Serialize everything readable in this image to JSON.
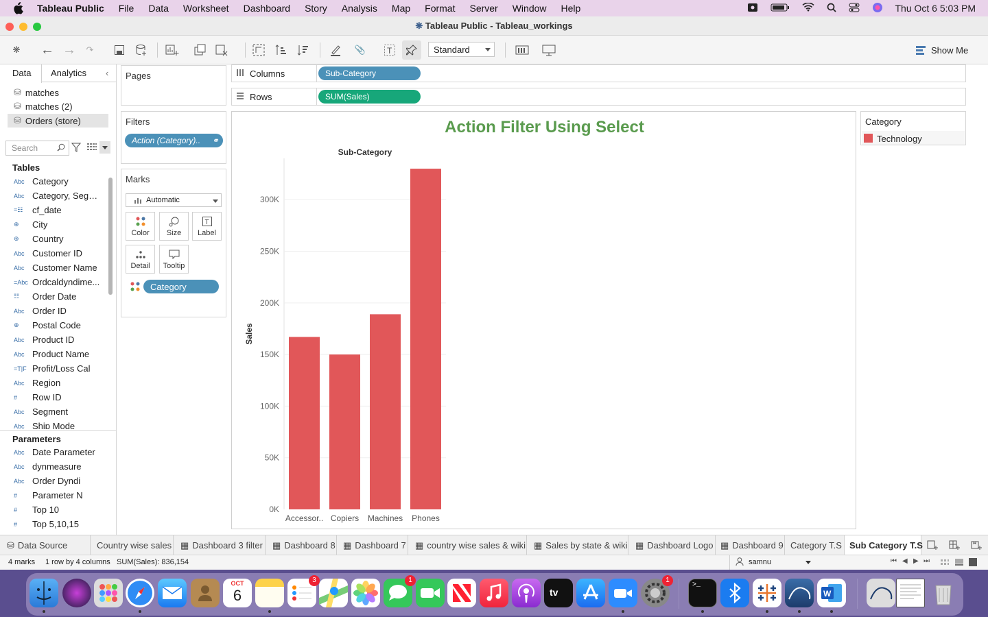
{
  "menubar": {
    "app": "Tableau Public",
    "items": [
      "File",
      "Data",
      "Worksheet",
      "Dashboard",
      "Story",
      "Analysis",
      "Map",
      "Format",
      "Server",
      "Window",
      "Help"
    ],
    "clock": "Thu Oct 6  5:03 PM"
  },
  "window": {
    "title": "Tableau Public - Tableau_workings"
  },
  "toolbar": {
    "fit": "Standard",
    "show_me": "Show Me"
  },
  "datapane": {
    "tab_data": "Data",
    "tab_analytics": "Analytics",
    "sources": [
      "matches",
      "matches (2)",
      "Orders (store)"
    ],
    "search_placeholder": "Search",
    "tables_heading": "Tables",
    "fields": [
      {
        "t": "Abc",
        "n": "Category"
      },
      {
        "t": "Abc",
        "n": "Category, Segm..."
      },
      {
        "t": "=☷",
        "n": "cf_date"
      },
      {
        "t": "⊕",
        "n": "City"
      },
      {
        "t": "⊕",
        "n": "Country"
      },
      {
        "t": "Abc",
        "n": "Customer ID"
      },
      {
        "t": "Abc",
        "n": "Customer Name"
      },
      {
        "t": "=Abc",
        "n": "Ordcaldyndime..."
      },
      {
        "t": "☷",
        "n": "Order Date"
      },
      {
        "t": "Abc",
        "n": "Order ID"
      },
      {
        "t": "⊕",
        "n": "Postal Code"
      },
      {
        "t": "Abc",
        "n": "Product ID"
      },
      {
        "t": "Abc",
        "n": "Product Name"
      },
      {
        "t": "=T|F",
        "n": "Profit/Loss Cal"
      },
      {
        "t": "Abc",
        "n": "Region"
      },
      {
        "t": "#",
        "n": "Row ID"
      },
      {
        "t": "Abc",
        "n": "Segment"
      },
      {
        "t": "Abc",
        "n": "Ship Mode"
      }
    ],
    "parameters_heading": "Parameters",
    "parameters": [
      {
        "t": "Abc",
        "n": "Date Parameter"
      },
      {
        "t": "Abc",
        "n": "dynmeasure"
      },
      {
        "t": "Abc",
        "n": "Order Dyndi"
      },
      {
        "t": "#",
        "n": "Parameter N"
      },
      {
        "t": "#",
        "n": "Top 10"
      },
      {
        "t": "#",
        "n": "Top 5,10,15"
      }
    ]
  },
  "cards": {
    "pages": "Pages",
    "filters": "Filters",
    "filter_pill": "Action (Category)..",
    "marks": "Marks",
    "mark_type": "Automatic",
    "buttons": [
      "Color",
      "Size",
      "Label",
      "Detail",
      "Tooltip"
    ],
    "marks_pill": "Category"
  },
  "shelves": {
    "columns_label": "Columns",
    "columns_pill": "Sub-Category",
    "rows_label": "Rows",
    "rows_pill": "SUM(Sales)"
  },
  "legend": {
    "title": "Category",
    "item": "Technology",
    "color": "#e15759"
  },
  "chart_data": {
    "type": "bar",
    "title": "Action Filter Using Select",
    "header": "Sub-Category",
    "ylabel": "Sales",
    "categories": [
      "Accessor..",
      "Copiers",
      "Machines",
      "Phones"
    ],
    "values": [
      167000,
      150000,
      189000,
      330000
    ],
    "ylim": [
      0,
      340000
    ],
    "yticks": [
      0,
      50000,
      100000,
      150000,
      200000,
      250000,
      300000
    ],
    "ytick_labels": [
      "0K",
      "50K",
      "100K",
      "150K",
      "200K",
      "250K",
      "300K"
    ],
    "color": "#e15759",
    "grid": true
  },
  "sheet_tabs": [
    "Data Source",
    "Country wise sales",
    "Dashboard 3 filter",
    "Dashboard 8",
    "Dashboard 7",
    "country wise sales & wiki",
    "Sales by state & wiki",
    "Dashboard Logo",
    "Dashboard 9",
    "Category T.S",
    "Sub Category T.S"
  ],
  "status": {
    "marks": "4 marks",
    "dims": "1 row by 4 columns",
    "sum": "SUM(Sales): 836,154",
    "user": "samnu"
  },
  "dock": {
    "calendar_month": "OCT",
    "calendar_day": "6",
    "badges": {
      "reminders": "3",
      "messages": "1",
      "settings": "1"
    }
  }
}
